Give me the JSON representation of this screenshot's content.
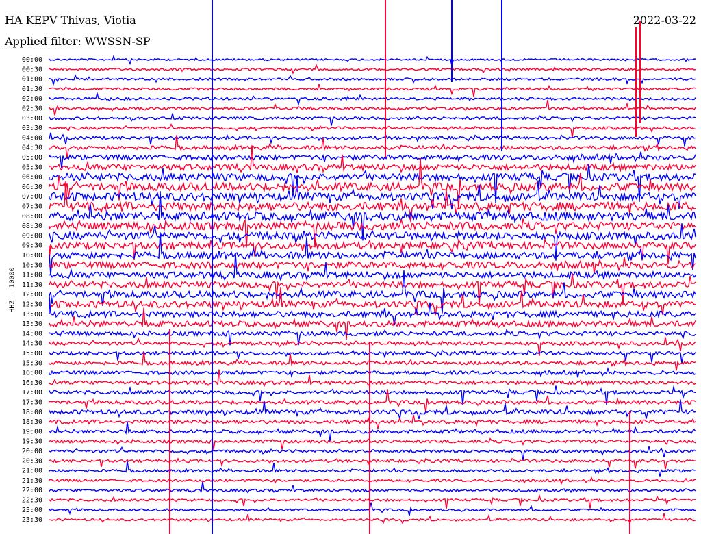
{
  "header": {
    "station": "HA KEPV Thivas, Viotia",
    "date": "2022-03-22",
    "filter": "Applied filter: WWSSN-SP"
  },
  "axis": {
    "ylabel": "HHZ - 10000"
  },
  "chart_data": {
    "type": "line",
    "title": "HA KEPV Thivas, Viotia",
    "subtitle": "Applied filter: WWSSN-SP",
    "ylabel": "HHZ - 10000",
    "row_labels": [
      "00:00",
      "00:30",
      "01:00",
      "01:30",
      "02:00",
      "02:30",
      "03:00",
      "03:30",
      "04:00",
      "04:30",
      "05:00",
      "05:30",
      "06:00",
      "06:30",
      "07:00",
      "07:30",
      "08:00",
      "08:30",
      "09:00",
      "09:30",
      "10:00",
      "10:30",
      "11:00",
      "11:30",
      "12:00",
      "12:30",
      "13:00",
      "13:30",
      "14:00",
      "14:30",
      "15:00",
      "15:30",
      "16:00",
      "16:30",
      "17:00",
      "17:30",
      "18:00",
      "18:30",
      "19:00",
      "19:30",
      "20:00",
      "20:30",
      "21:00",
      "21:30",
      "22:00",
      "22:30",
      "23:00",
      "23:30"
    ],
    "series_colors": [
      "#0000ff",
      "#ff0033"
    ],
    "activity": [
      0.6,
      0.7,
      0.7,
      0.8,
      0.8,
      0.8,
      0.9,
      0.9,
      1.0,
      1.2,
      1.6,
      2.0,
      2.4,
      2.6,
      2.6,
      2.8,
      2.8,
      2.6,
      2.4,
      2.2,
      2.2,
      2.2,
      2.0,
      2.0,
      2.2,
      2.2,
      2.0,
      1.8,
      1.4,
      1.2,
      1.1,
      1.1,
      1.2,
      1.2,
      1.2,
      1.2,
      1.4,
      1.2,
      1.1,
      1.0,
      0.9,
      0.9,
      0.9,
      0.8,
      0.8,
      0.8,
      0.7,
      0.7
    ]
  }
}
